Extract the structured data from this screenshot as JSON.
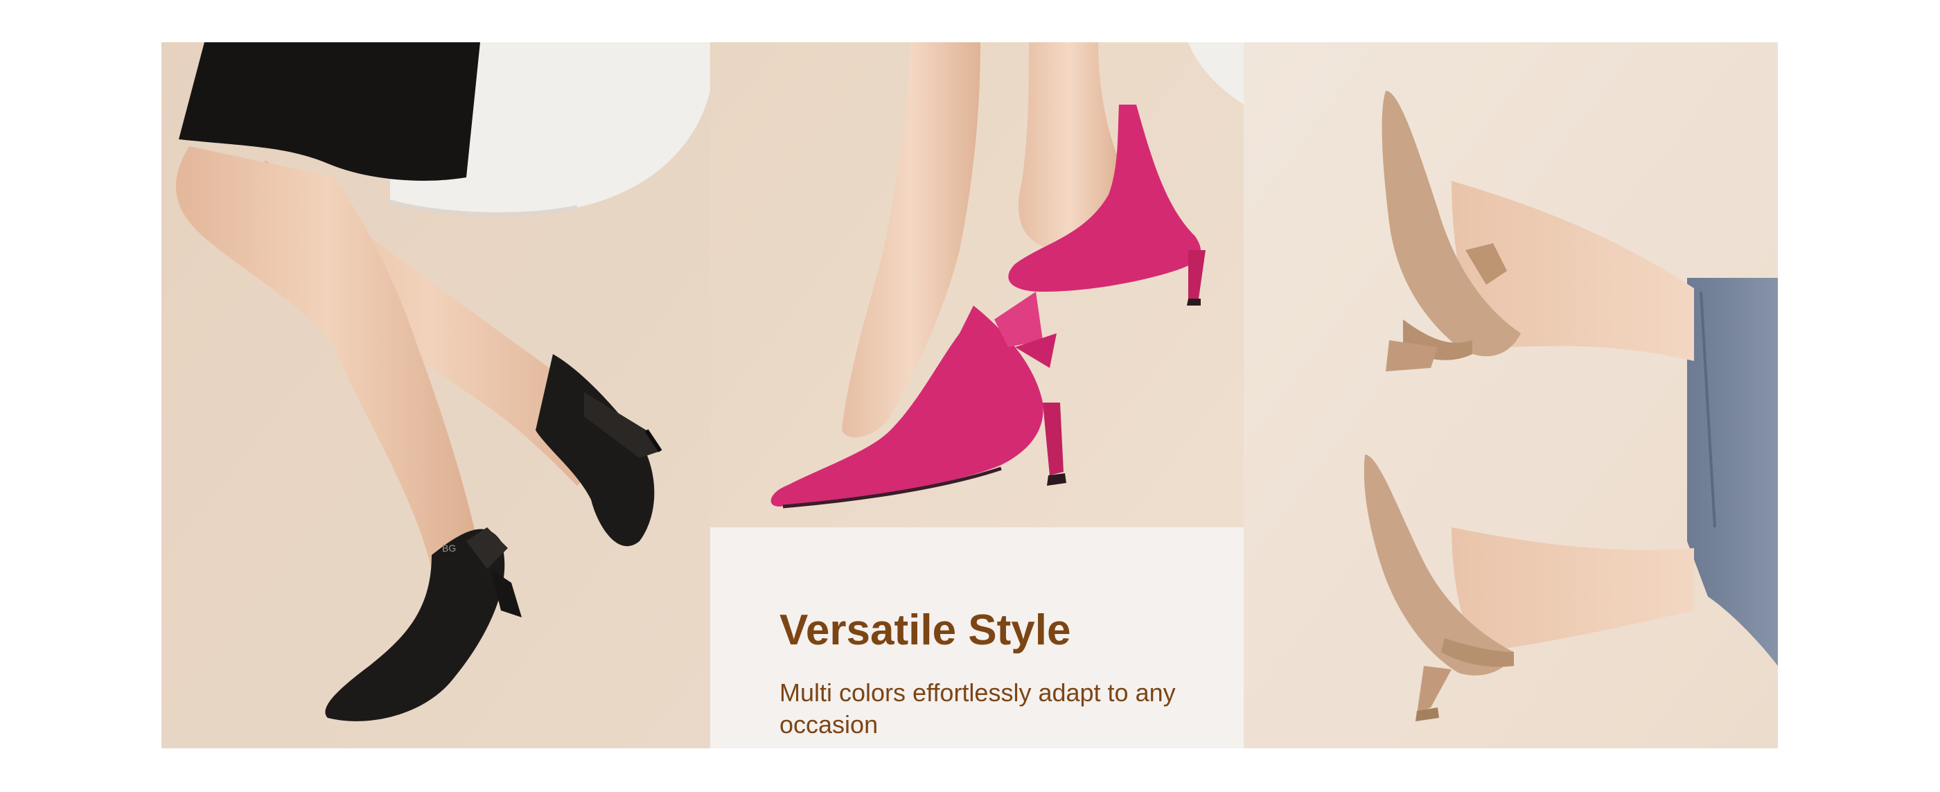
{
  "feature": {
    "title": "Versatile Style",
    "subtitle": "Multi colors effortlessly adapt to any occasion"
  },
  "photos": [
    {
      "subject": "black knit slingback pointed-toe heels with bow",
      "shoe_color": "#1c1a19"
    },
    {
      "subject": "fuchsia knit slingback pointed-toe heels with bow",
      "shoe_color": "#d42a72"
    },
    {
      "subject": "nude knit slingback pointed-toe heels with bow",
      "shoe_color": "#c9a487"
    }
  ],
  "colors": {
    "backdrop": "#e8d6c4",
    "caption_background": "#f5f1ef",
    "caption_text": "#7c4514"
  }
}
